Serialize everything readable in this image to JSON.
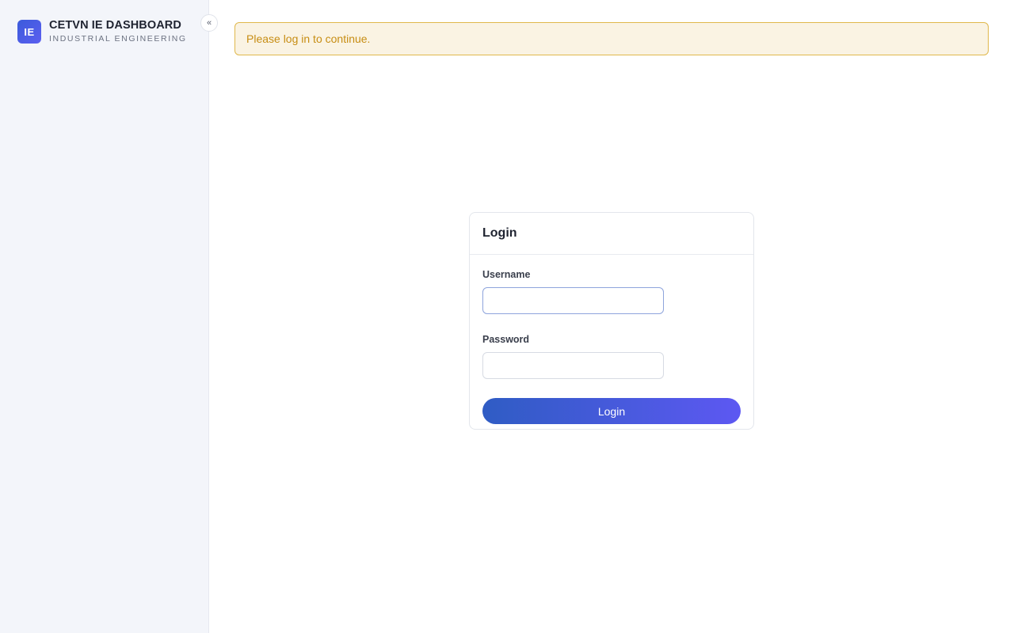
{
  "sidebar": {
    "logo_text": "IE",
    "title": "CETVN IE DASHBOARD",
    "subtitle": "INDUSTRIAL ENGINEERING",
    "collapse_icon": "«"
  },
  "alert": {
    "message": "Please log in to continue."
  },
  "login_card": {
    "title": "Login",
    "username_label": "Username",
    "username_value": "",
    "password_label": "Password",
    "password_value": "",
    "submit_label": "Login"
  },
  "colors": {
    "accent_start": "#2f5cc4",
    "accent_end": "#5d58f2",
    "alert_background": "#faf3e3",
    "alert_border": "#e0b84c",
    "alert_text": "#c78d13",
    "sidebar_background": "#f3f5fa"
  },
  "icons": {
    "collapse": "chevrons-left-icon"
  }
}
